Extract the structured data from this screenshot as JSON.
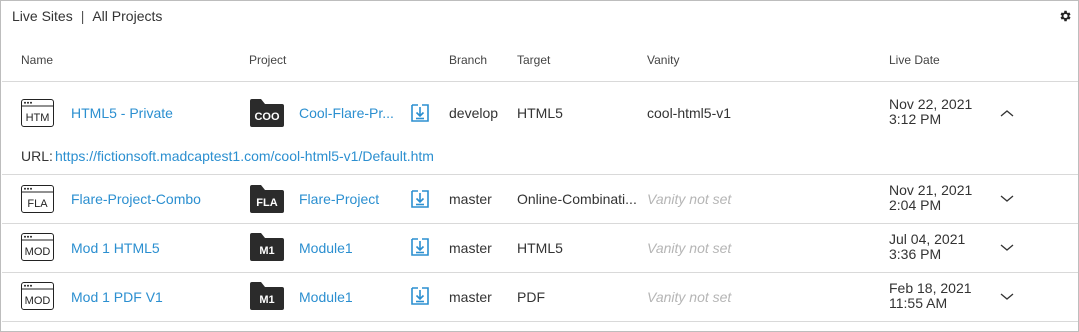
{
  "breadcrumb": {
    "live_sites": "Live Sites",
    "separator": "|",
    "all_projects": "All Projects"
  },
  "icons": {
    "settings": "gear-icon",
    "download": "download-icon",
    "expand": "chevron-down-icon",
    "collapse": "chevron-up-icon"
  },
  "colors": {
    "link": "#2b8fd0",
    "muted": "#b5b5b5",
    "folder": "#2b2b2b"
  },
  "columns": {
    "name": "Name",
    "project": "Project",
    "branch": "Branch",
    "target": "Target",
    "vanity": "Vanity",
    "live_date": "Live Date"
  },
  "rows": [
    {
      "icon_label": "HTM",
      "name": "HTML5 - Private",
      "project_badge": "COO",
      "project": "Cool-Flare-Pr...",
      "branch": "develop",
      "target": "HTML5",
      "vanity": "cool-html5-v1",
      "date": "Nov 22, 2021",
      "time": "3:12 PM",
      "expanded": true,
      "url_label": "URL:",
      "url": "https://fictionsoft.madcaptest1.com/cool-html5-v1/Default.htm"
    },
    {
      "icon_label": "FLA",
      "name": "Flare-Project-Combo",
      "project_badge": "FLA",
      "project": "Flare-Project",
      "branch": "master",
      "target": "Online-Combinati...",
      "vanity": "Vanity not set",
      "date": "Nov 21, 2021",
      "time": "2:04 PM",
      "expanded": false
    },
    {
      "icon_label": "MOD",
      "name": "Mod 1 HTML5",
      "project_badge": "M1",
      "project": "Module1",
      "branch": "master",
      "target": "HTML5",
      "vanity": "Vanity not set",
      "date": "Jul 04, 2021",
      "time": "3:36 PM",
      "expanded": false
    },
    {
      "icon_label": "MOD",
      "name": "Mod 1 PDF V1",
      "project_badge": "M1",
      "project": "Module1",
      "branch": "master",
      "target": "PDF",
      "vanity": "Vanity not set",
      "date": "Feb 18, 2021",
      "time": "11:55 AM",
      "expanded": false
    }
  ]
}
